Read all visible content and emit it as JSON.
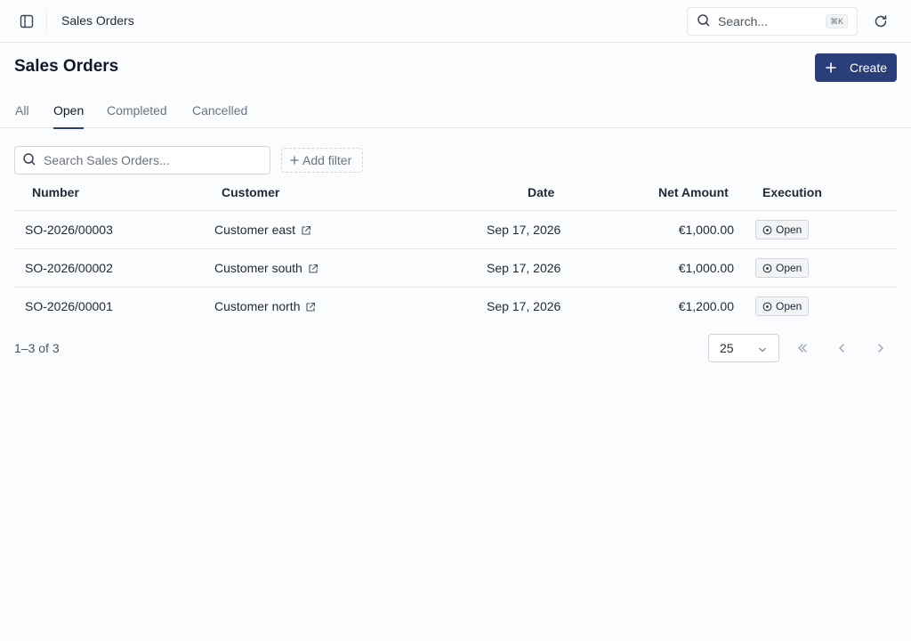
{
  "topbar": {
    "title": "Sales Orders",
    "search_label": "Search...",
    "search_shortcut": "⌘K"
  },
  "page": {
    "title": "Sales Orders",
    "create_label": "Create"
  },
  "tabs": [
    {
      "label": "All",
      "active": false
    },
    {
      "label": "Open",
      "active": true
    },
    {
      "label": "Completed",
      "active": false
    },
    {
      "label": "Cancelled",
      "active": false
    }
  ],
  "filters": {
    "search_placeholder": "Search Sales Orders...",
    "add_filter_label": "Add filter"
  },
  "table": {
    "columns": [
      "Number",
      "Customer",
      "Date",
      "Net Amount",
      "Execution"
    ],
    "rows": [
      {
        "number": "SO-2026/00003",
        "customer": "Customer east",
        "date": "Sep 17, 2026",
        "net_amount": "€1,000.00",
        "execution": "Open"
      },
      {
        "number": "SO-2026/00002",
        "customer": "Customer south",
        "date": "Sep 17, 2026",
        "net_amount": "€1,000.00",
        "execution": "Open"
      },
      {
        "number": "SO-2026/00001",
        "customer": "Customer north",
        "date": "Sep 17, 2026",
        "net_amount": "€1,200.00",
        "execution": "Open"
      }
    ]
  },
  "footer": {
    "range_text": "1–3 of 3",
    "page_size": "25"
  },
  "colors": {
    "accent": "#2a3f7a",
    "border": "#e5e7eb",
    "background": "#fbfcfe"
  },
  "icons": {
    "sidebar": "sidebar-toggle-icon",
    "search": "search-icon",
    "refresh": "refresh-icon",
    "plus": "plus-icon",
    "external": "external-link-icon",
    "status": "circle-dot-icon",
    "first": "chevrons-left-icon",
    "prev": "chevron-left-icon",
    "next": "chevron-right-icon"
  }
}
